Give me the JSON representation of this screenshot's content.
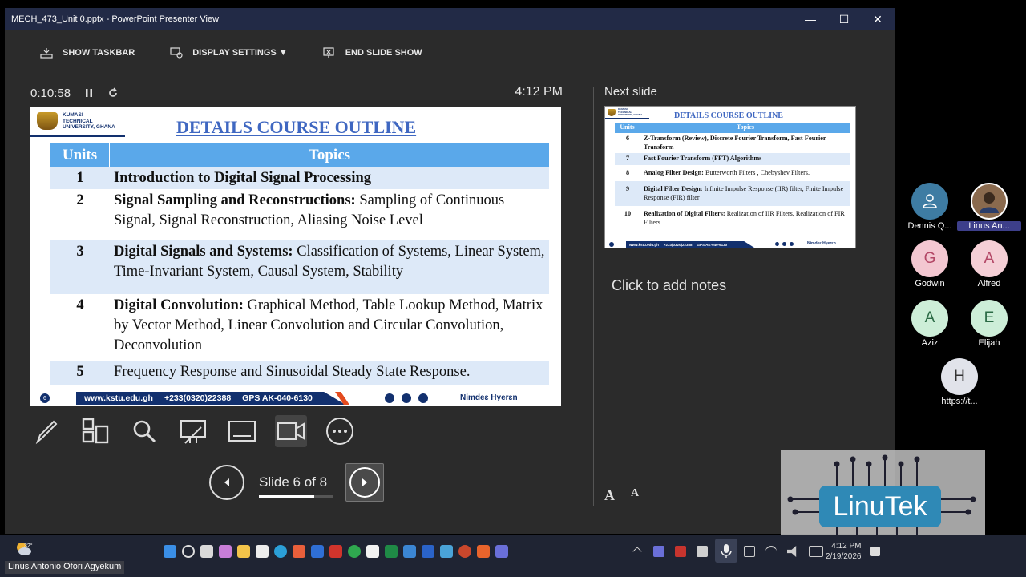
{
  "window": {
    "title": "MECH_473_Unit 0.pptx - PowerPoint Presenter View",
    "controls": {
      "minimize": "—",
      "maximize": "☐",
      "close": "✕"
    }
  },
  "toolbar": {
    "show_taskbar": "SHOW TASKBAR",
    "display_settings": "DISPLAY SETTINGS ▼",
    "end_slide_show": "END SLIDE SHOW"
  },
  "timer": {
    "elapsed": "0:10:58",
    "clock": "4:12 PM"
  },
  "current_slide": {
    "logo_lines": [
      "KUMASI",
      "TECHNICAL",
      "UNIVERSITY, GHANA"
    ],
    "title": "DETAILS COURSE OUTLINE",
    "header": {
      "units": "Units",
      "topics": "Topics"
    },
    "rows": [
      {
        "unit": "1",
        "bold": "Introduction to Digital Signal Processing",
        "text": ""
      },
      {
        "unit": "2",
        "bold": "Signal Sampling and Reconstructions:",
        "text": " Sampling of Continuous Signal, Signal Reconstruction, Aliasing Noise Level"
      },
      {
        "unit": "3",
        "bold": "Digital Signals and Systems:",
        "text": " Classification of Systems, Linear System, Time-Invariant System, Causal System, Stability"
      },
      {
        "unit": "4",
        "bold": "Digital Convolution:",
        "text": " Graphical Method, Table Lookup Method, Matrix by Vector Method, Linear Convolution and Circular Convolution, Deconvolution"
      },
      {
        "unit": "5",
        "bold": "",
        "text": "Frequency Response and Sinusoidal Steady State Response."
      }
    ],
    "footer": {
      "page": "6",
      "website": "www.kstu.edu.gh",
      "phone": "+233(0320)22388",
      "gps": "GPS AK-040-6130",
      "motto": "Nimdeɛ Hyerɛn"
    }
  },
  "navigation": {
    "label": "Slide 6 of 8",
    "progress": 0.75
  },
  "tools": [
    "pen-icon",
    "slides-grid-icon",
    "zoom-icon",
    "laser-pointer-icon",
    "subtitles-icon",
    "camera-icon",
    "more-options-icon"
  ],
  "next_slide": {
    "label": "Next slide",
    "logo_lines": [
      "KUMASI",
      "TECHNICAL",
      "UNIVERSITY, GHANA"
    ],
    "title": "DETAILS COURSE OUTLINE",
    "header": {
      "units": "Units",
      "topics": "Topics"
    },
    "rows": [
      {
        "unit": "6",
        "bold": "Z-Transform (Review), Discrete Fourier Transform, Fast Fourier Transform",
        "text": ""
      },
      {
        "unit": "7",
        "bold": "Fast Fourier Transform (FFT) Algorithms",
        "text": ""
      },
      {
        "unit": "8",
        "bold": "Analog Filter Design:",
        "text": " Butterworth Filters , Chebyshev Filters."
      },
      {
        "unit": "9",
        "bold": "Digital Filter Design:",
        "text": " Infinite Impulse Response (IIR) filter, Finite Impulse Response (FIR) filter"
      },
      {
        "unit": "10",
        "bold": "Realization of Digital Filters:",
        "text": " Realization of IIR Filters, Realization of FIR Filters"
      }
    ],
    "footer": {
      "website": "www.kstu.edu.gh",
      "phone": "+233(0320)22388",
      "gps": "GPS AK-040-6130",
      "motto": "Nimdeɛ Hyerɛn"
    }
  },
  "notes": {
    "placeholder": "Click to add notes"
  },
  "font_controls": {
    "increase": "A",
    "decrease": "A"
  },
  "participants": [
    {
      "initial": "",
      "name": "Dennis Q...",
      "color": "#3e7ca3"
    },
    {
      "initial": "",
      "name": "Linus An...",
      "color": "#8a6a4e"
    },
    {
      "initial": "G",
      "name": "Godwin",
      "color": "#f3c7d1"
    },
    {
      "initial": "A",
      "name": "Alfred",
      "color": "#f5cfd6"
    },
    {
      "initial": "A",
      "name": "Aziz",
      "color": "#cdeed8"
    },
    {
      "initial": "E",
      "name": "Elijah",
      "color": "#cdeed8"
    },
    {
      "initial": "H",
      "name": "https://t...",
      "color": "#e1e3ea"
    }
  ],
  "watermark": {
    "text": "LinuTek"
  },
  "taskbar": {
    "temperature": "32°",
    "user": "Linus Antonio Ofori Agyekum",
    "time": "4:12 PM",
    "date": "2/19/2026"
  }
}
